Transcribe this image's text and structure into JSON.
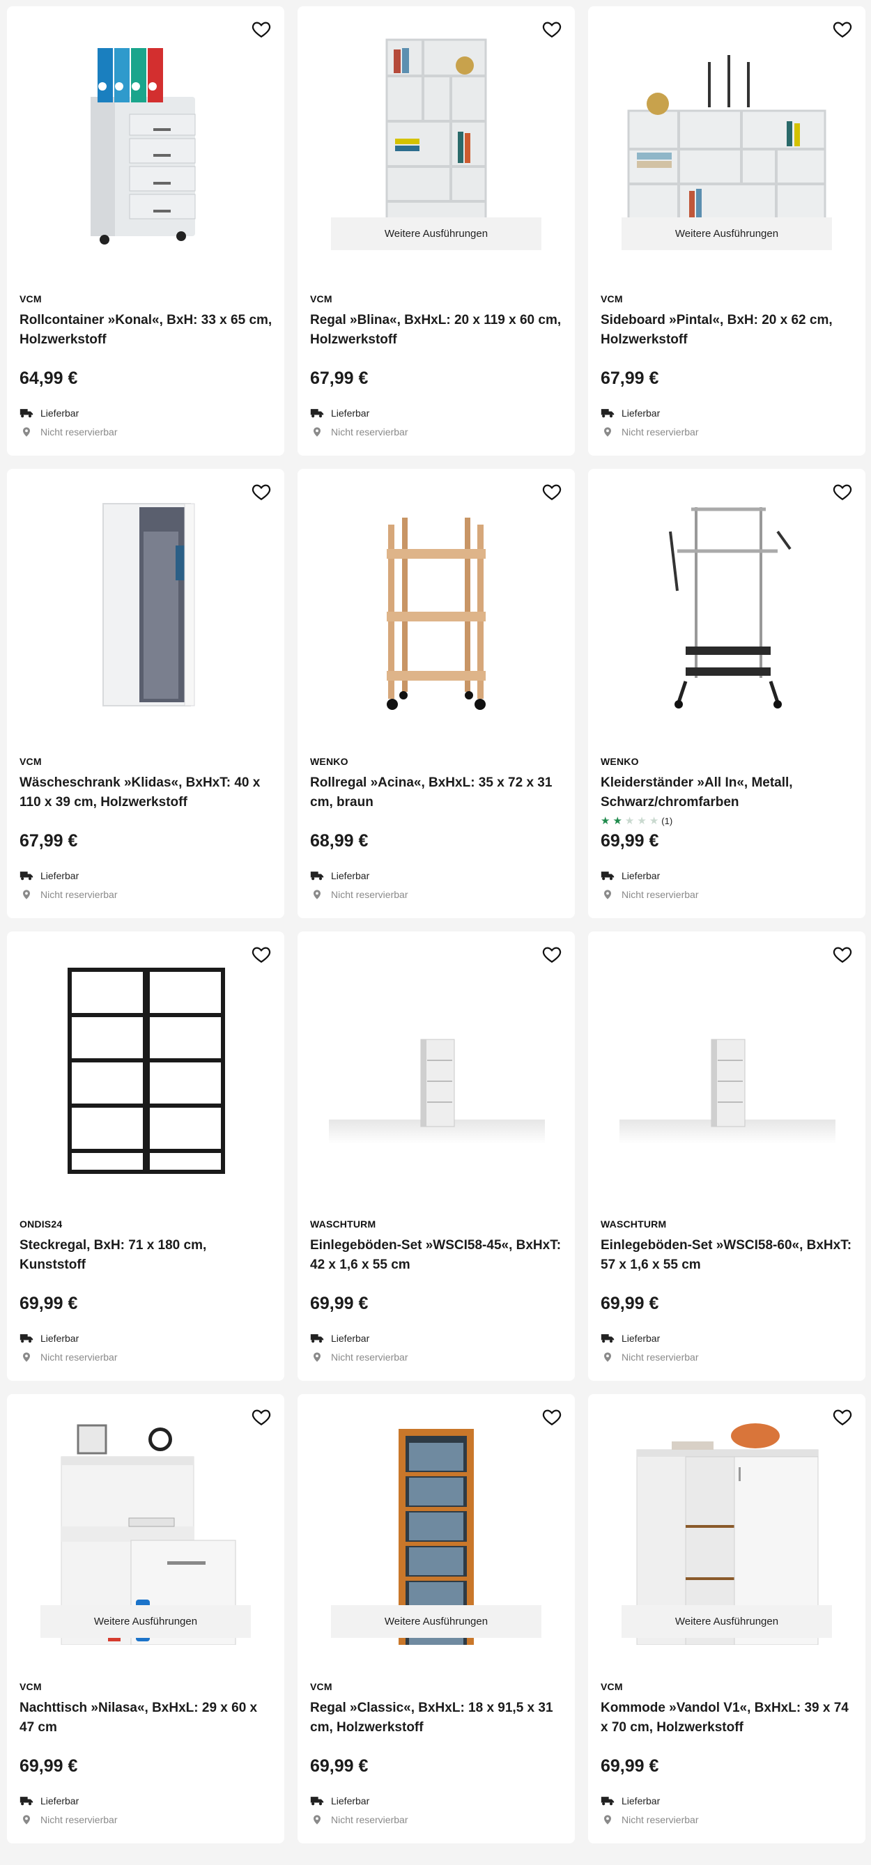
{
  "variant_label": "Weitere Ausführungen",
  "delivery_label": "Lieferbar",
  "reserve_label": "Nicht reservierbar",
  "icons": {
    "favorite": "heart-outline-icon",
    "delivery": "truck-icon",
    "store": "location-pin-icon"
  },
  "colors": {
    "rating_star": "#1f8a4c",
    "reserve_text": "#8a8a8a"
  },
  "products": [
    {
      "brand": "VCM",
      "title": "Rollcontainer »Konal«, BxH: 33 x 65 cm, Holzwerkstoff",
      "price": "64,99 €",
      "variants": false,
      "image": "rolling-drawer-container"
    },
    {
      "brand": "VCM",
      "title": "Regal »Blina«, BxHxL: 20 x 119 x 60 cm, Holzwerkstoff",
      "price": "67,99 €",
      "variants": true,
      "image": "white-bookshelf"
    },
    {
      "brand": "VCM",
      "title": "Sideboard »Pintal«, BxH: 20 x 62 cm, Holzwerkstoff",
      "price": "67,99 €",
      "variants": true,
      "image": "white-sideboard-shelf"
    },
    {
      "brand": "VCM",
      "title": "Wäscheschrank »Klidas«, BxHxT: 40 x 110 x 39 cm, Holzwerkstoff",
      "price": "67,99 €",
      "variants": false,
      "image": "laundry-cabinet"
    },
    {
      "brand": "WENKO",
      "title": "Rollregal »Acina«, BxHxL: 35 x 72 x 31 cm, braun",
      "price": "68,99 €",
      "variants": false,
      "image": "wooden-rolling-shelf"
    },
    {
      "brand": "WENKO",
      "title": "Kleiderständer »All In«, Metall, Schwarz/chromfarben",
      "price": "69,99 €",
      "variants": false,
      "image": "clothes-rack",
      "rating": {
        "stars": 2,
        "max": 5,
        "count_label": "(1)"
      }
    },
    {
      "brand": "ONDIS24",
      "title": "Steckregal, BxH: 71 x 180 cm, Kunststoff",
      "price": "69,99 €",
      "variants": false,
      "image": "black-plastic-shelves"
    },
    {
      "brand": "WASCHTURM",
      "title": "Einlegeböden-Set »WSCI58-45«, BxHxT: 42 x 1,6 x 55 cm",
      "price": "69,99 €",
      "variants": false,
      "image": "washer-tower-shelf"
    },
    {
      "brand": "WASCHTURM",
      "title": "Einlegeböden-Set »WSCI58-60«, BxHxT: 57 x 1,6 x 55 cm",
      "price": "69,99 €",
      "variants": false,
      "image": "washer-tower-shelf"
    },
    {
      "brand": "VCM",
      "title": "Nachttisch »Nilasa«, BxHxL: 29 x 60 x 47 cm",
      "price": "69,99 €",
      "variants": true,
      "image": "white-nightstand"
    },
    {
      "brand": "VCM",
      "title": "Regal »Classic«, BxHxL: 18 x 91,5 x 31 cm, Holzwerkstoff",
      "price": "69,99 €",
      "variants": true,
      "image": "media-shelf"
    },
    {
      "brand": "VCM",
      "title": "Kommode »Vandol V1«, BxHxL: 39 x 74 x 70 cm, Holzwerkstoff",
      "price": "69,99 €",
      "variants": true,
      "image": "white-commode"
    }
  ]
}
